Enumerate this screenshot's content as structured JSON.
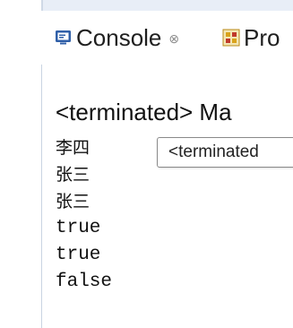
{
  "tabs": [
    {
      "label": "Console",
      "close": "⊗",
      "icon": "console-icon",
      "active": true
    },
    {
      "label": "Pro",
      "icon": "problems-icon",
      "active": false
    }
  ],
  "console": {
    "heading": "<terminated> Ma",
    "tooltip": "<terminated",
    "lines": [
      "李四",
      "张三",
      "张三",
      "true",
      "true",
      "false"
    ]
  },
  "colors": {
    "console_icon": "#2f5fa8",
    "problems_icon": "#d9a21b",
    "tab_strip": "#e8eef7"
  }
}
